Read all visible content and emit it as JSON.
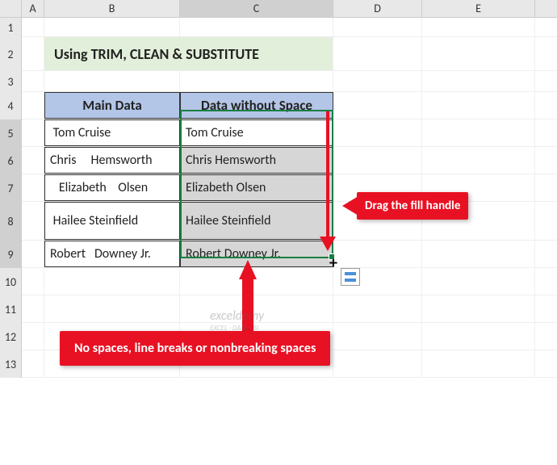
{
  "columns": {
    "A": "A",
    "B": "B",
    "C": "C",
    "D": "D",
    "E": "E"
  },
  "rows": {
    "r1": "1",
    "r2": "2",
    "r3": "3",
    "r4": "4",
    "r5": "5",
    "r6": "6",
    "r7": "7",
    "r8": "8",
    "r9": "9",
    "r10": "10",
    "r11": "11",
    "r12": "12",
    "r13": "13"
  },
  "title": "Using TRIM, CLEAN & SUBSTITUTE",
  "headers": {
    "main": "Main Data",
    "result": "Data without Space"
  },
  "data": {
    "main": [
      " Tom Cruise",
      "Chris     Hemsworth",
      "   Elizabeth    Olsen",
      " Hailee Steinfield",
      "Robert   Downey Jr."
    ],
    "result": [
      "Tom Cruise",
      "Chris Hemsworth",
      "Elizabeth Olsen",
      "Hailee Steinfield",
      "Robert Downey Jr."
    ]
  },
  "callouts": {
    "drag": "Drag the fill handle",
    "bottom": "No spaces, line breaks or nonbreaking spaces"
  },
  "watermark": {
    "main": "exceldemy",
    "sub": "EXCEL · DATA · BI"
  }
}
